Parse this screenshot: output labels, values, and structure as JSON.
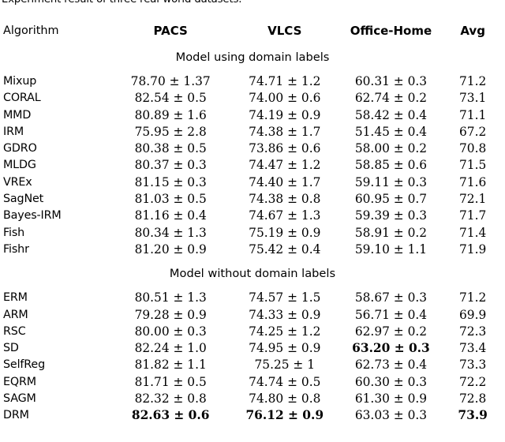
{
  "caption": "Experiment result of three real-world datasets.",
  "table": {
    "columns": [
      {
        "key": "algorithm",
        "label": "Algorithm",
        "align": "left"
      },
      {
        "key": "pacs",
        "label": "PACS",
        "align": "center"
      },
      {
        "key": "vlcs",
        "label": "VLCS",
        "align": "center"
      },
      {
        "key": "office_home",
        "label": "Office-Home",
        "align": "center"
      },
      {
        "key": "avg",
        "label": "Avg",
        "align": "center"
      }
    ],
    "sections": [
      {
        "label": "Model using domain labels",
        "rows": [
          {
            "algorithm": "Mixup",
            "pacs": "78.70 ± 1.37",
            "vlcs": "74.71 ± 1.2",
            "office_home": "60.31 ± 0.3",
            "avg": "71.2"
          },
          {
            "algorithm": "CORAL",
            "pacs": "82.54 ± 0.5",
            "vlcs": "74.00 ± 0.6",
            "office_home": "62.74 ± 0.2",
            "avg": "73.1"
          },
          {
            "algorithm": "MMD",
            "pacs": "80.89 ± 1.6",
            "vlcs": "74.19 ± 0.9",
            "office_home": "58.42 ± 0.4",
            "avg": "71.1"
          },
          {
            "algorithm": "IRM",
            "pacs": "75.95 ± 2.8",
            "vlcs": "74.38 ± 1.7",
            "office_home": "51.45 ± 0.4",
            "avg": "67.2"
          },
          {
            "algorithm": "GDRO",
            "pacs": "80.38 ± 0.5",
            "vlcs": "73.86 ± 0.6",
            "office_home": "58.00 ± 0.2",
            "avg": "70.8"
          },
          {
            "algorithm": "MLDG",
            "pacs": "80.37 ± 0.3",
            "vlcs": "74.47 ± 1.2",
            "office_home": "58.85 ± 0.6",
            "avg": "71.5"
          },
          {
            "algorithm": "VREx",
            "pacs": "81.15 ± 0.3",
            "vlcs": "74.40 ± 1.7",
            "office_home": "59.11 ± 0.3",
            "avg": "71.6"
          },
          {
            "algorithm": "SagNet",
            "pacs": "81.03 ± 0.5",
            "vlcs": "74.38 ± 0.8",
            "office_home": "60.95 ± 0.7",
            "avg": "72.1"
          },
          {
            "algorithm": "Bayes-IRM",
            "pacs": "81.16 ± 0.4",
            "vlcs": "74.67 ± 1.3",
            "office_home": "59.39 ± 0.3",
            "avg": "71.7"
          },
          {
            "algorithm": "Fish",
            "pacs": "80.34 ± 1.3",
            "vlcs": "75.19 ± 0.9",
            "office_home": "58.91 ± 0.2",
            "avg": "71.4"
          },
          {
            "algorithm": "Fishr",
            "pacs": "81.20 ± 0.9",
            "vlcs": "75.42 ± 0.4",
            "office_home": "59.10 ± 1.1",
            "avg": "71.9"
          }
        ]
      },
      {
        "label": "Model without domain labels",
        "rows": [
          {
            "algorithm": "ERM",
            "pacs": "80.51 ± 1.3",
            "vlcs": "74.57 ± 1.5",
            "office_home": "58.67 ± 0.3",
            "avg": "71.2"
          },
          {
            "algorithm": "ARM",
            "pacs": "79.28 ± 0.9",
            "vlcs": "74.33 ± 0.9",
            "office_home": "56.71 ± 0.4",
            "avg": "69.9"
          },
          {
            "algorithm": "RSC",
            "pacs": "80.00 ± 0.3",
            "vlcs": "74.25 ± 1.2",
            "office_home": "62.97 ± 0.2",
            "avg": "72.3"
          },
          {
            "algorithm": "SD",
            "pacs": "82.24 ± 1.0",
            "vlcs": "74.95 ± 0.9",
            "office_home": "63.20 ± 0.3",
            "avg": "73.4",
            "bold": [
              "office_home"
            ]
          },
          {
            "algorithm": "SelfReg",
            "pacs": "81.82 ± 1.1",
            "vlcs": "75.25 ± 1",
            "office_home": "62.73 ± 0.4",
            "avg": "73.3"
          },
          {
            "algorithm": "EQRM",
            "pacs": "81.71 ± 0.5",
            "vlcs": "74.74 ± 0.5",
            "office_home": "60.30 ± 0.3",
            "avg": "72.2"
          },
          {
            "algorithm": "SAGM",
            "pacs": "82.32 ± 0.8",
            "vlcs": "74.80 ± 0.8",
            "office_home": "61.30 ± 0.9",
            "avg": "72.8"
          },
          {
            "algorithm": "DRM",
            "pacs": "82.63 ± 0.6",
            "vlcs": "76.12 ± 0.9",
            "office_home": "63.03 ± 0.3",
            "avg": "73.9",
            "bold": [
              "pacs",
              "vlcs",
              "avg"
            ]
          }
        ]
      }
    ]
  },
  "colors": {
    "rule": "#000000",
    "text": "#000000",
    "background": "#ffffff"
  }
}
